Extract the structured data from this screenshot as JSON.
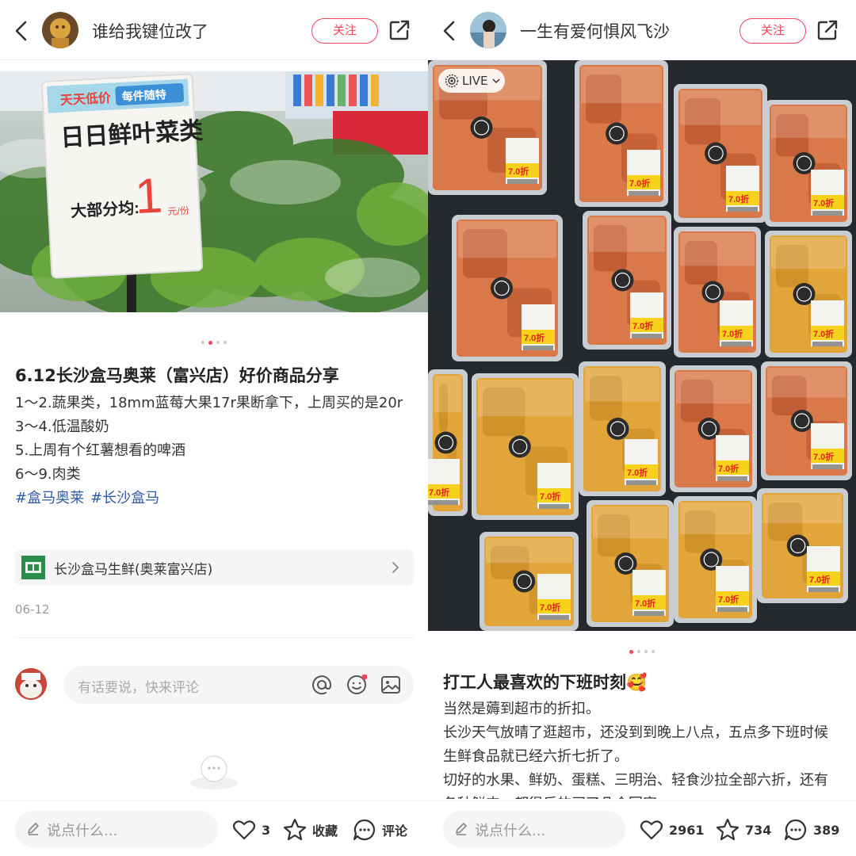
{
  "left": {
    "username": "谁给我键位改了",
    "follow_label": "关注",
    "photo": {
      "sign_banner": "天天低价",
      "sign_banner2": "每件随特",
      "sign_line1": "日日鲜叶菜类",
      "sign_prefix": "大部分均:",
      "sign_price": "1",
      "sign_unit": "元/份"
    },
    "carousel": {
      "count": 4,
      "active": 1
    },
    "title": "6.12长沙盒马奥莱（富兴店）好价商品分享",
    "body_lines": [
      "1～2.蔬果类，18mm蓝莓大果17r果断拿下，上周买的是20r",
      "3～4.低温酸奶",
      "5.上周有个红薯想看的啤酒",
      "6～9.肉类"
    ],
    "tags": [
      "#盒马奥莱",
      "#长沙盒马"
    ],
    "location": "长沙盒马生鲜(奥莱富兴店)",
    "date": "06-12",
    "comment_placeholder": "有话要说，快来评论",
    "bottom": {
      "say_placeholder": "说点什么...",
      "likes": "3",
      "collect_label": "收藏",
      "comment_label": "评论"
    }
  },
  "right": {
    "username": "一生有爱何惧风飞沙",
    "follow_label": "关注",
    "live_label": "LIVE",
    "photo": {
      "price_tag": "7.0折"
    },
    "carousel": {
      "count": 4,
      "active": 0
    },
    "title": "打工人最喜欢的下班时刻🥰",
    "body_lines": [
      "当然是薅到超市的折扣。",
      "长沙天气放晴了逛超市，还没到到晚上八点，五点多下班时候生鲜食品就已经六折七折了。",
      "切好的水果、鲜奶、蛋糕、三明治、轻食沙拉全部六折，还有各种鲜肉，都很乐的买了几个回家"
    ],
    "bottom": {
      "say_placeholder": "说点什么...",
      "likes": "2961",
      "collects": "734",
      "comments": "389"
    }
  },
  "colors": {
    "accent": "#f0445d",
    "tag": "#2f5aa6",
    "muted": "#999999"
  },
  "icons": [
    "back-icon",
    "share-icon",
    "at-icon",
    "emoji-icon",
    "image-icon",
    "pencil-icon",
    "heart-icon",
    "star-icon",
    "comment-icon",
    "chevron-right-icon",
    "live-icon"
  ]
}
